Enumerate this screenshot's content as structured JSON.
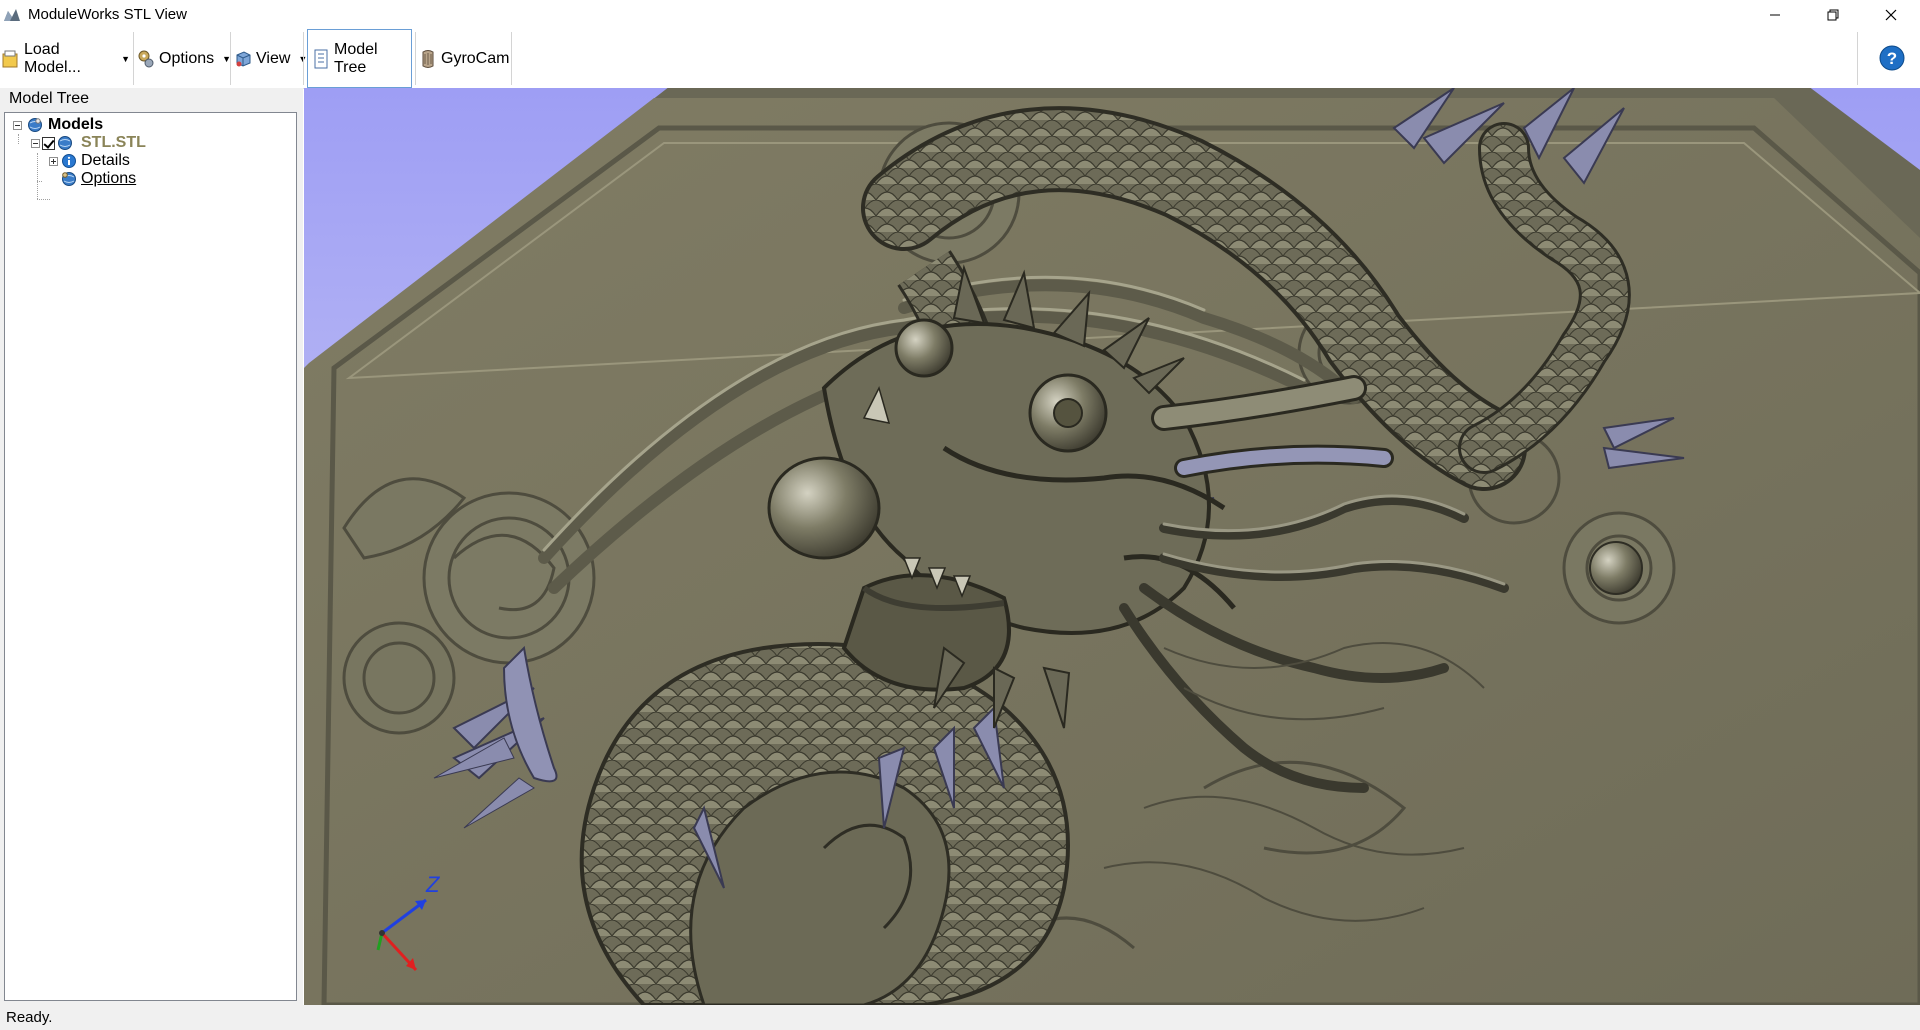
{
  "window": {
    "title": "ModuleWorks STL View",
    "controls": [
      "minimize",
      "restore",
      "close"
    ]
  },
  "toolbar": {
    "items": [
      {
        "label": "Load Model...",
        "icon": "folder-icon",
        "dropdown": true
      },
      {
        "label": "Options",
        "icon": "gears-icon",
        "dropdown": true
      },
      {
        "label": "View",
        "icon": "cube-view-icon",
        "dropdown": true
      },
      {
        "label": "Model Tree",
        "icon": "tree-doc-icon",
        "active": true
      },
      {
        "label": "GyroCam",
        "icon": "gyrocam-icon"
      }
    ],
    "help_icon": "help-icon"
  },
  "sidepanel": {
    "title": "Model Tree",
    "tree": {
      "root": {
        "label": "Models",
        "expanded": true
      },
      "model": {
        "label": "STL.STL",
        "checked": true,
        "expanded": true
      },
      "children": [
        {
          "label": "Details",
          "icon": "info-icon",
          "expandable": true
        },
        {
          "label": "Options",
          "icon": "options-globe-icon"
        }
      ]
    }
  },
  "viewport": {
    "background_top": "#9e9ef4",
    "background_bottom": "#d8d8f2",
    "model_color": "#7a7a66",
    "axis_label": "Z",
    "axis_colors": {
      "x": "#e02020",
      "y": "#20a020",
      "z": "#2040e0"
    }
  },
  "status": {
    "text": "Ready."
  }
}
